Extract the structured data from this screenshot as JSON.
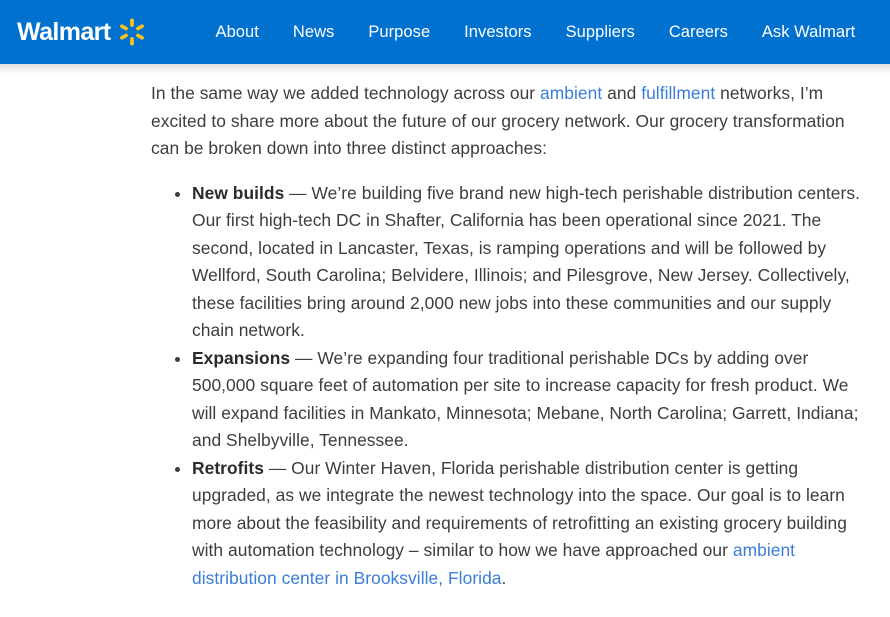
{
  "header": {
    "brand_name": "Walmart",
    "spark_icon": "walmart-spark-icon",
    "background_color": "#0071ce",
    "spark_color": "#ffc220",
    "nav": [
      {
        "label": "About"
      },
      {
        "label": "News"
      },
      {
        "label": "Purpose"
      },
      {
        "label": "Investors"
      },
      {
        "label": "Suppliers"
      },
      {
        "label": "Careers"
      },
      {
        "label": "Ask Walmart"
      }
    ]
  },
  "article": {
    "link_color": "#3b7dd8",
    "text_color": "#3d3d3d",
    "lede": {
      "part1": "In the same way we added technology across our ",
      "link1": "ambient",
      "part2": " and ",
      "link2": "fulfillment",
      "part3": " networks, I’m excited to share more about the future of our grocery network. Our grocery transformation can be broken down into three distinct approaches:"
    },
    "bullets": [
      {
        "term": "New builds",
        "body": " — We’re building five brand new high-tech perishable distribution centers. Our first high-tech DC in Shafter, California has been operational since 2021. The second, located in Lancaster, Texas, is ramping operations and will be followed by Wellford, South Carolina; Belvidere, Illinois; and Pilesgrove, New Jersey. Collectively, these facilities bring around 2,000 new jobs into these communities and our supply chain network."
      },
      {
        "term": "Expansions",
        "body": " — We’re expanding four traditional perishable DCs by adding over 500,000 square feet of automation per site to increase capacity for fresh product. We will expand facilities in Mankato, Minnesota; Mebane, North Carolina; Garrett, Indiana; and Shelbyville, Tennessee."
      },
      {
        "term": "Retrofits",
        "body_before_link": " — Our Winter Haven, Florida perishable distribution center is getting upgraded, as we integrate the newest technology into the space. Our goal is to learn more about the feasibility and requirements of retrofitting an existing grocery building with automation technology – similar to how we have approached our ",
        "link": "ambient distribution center in Brooksville, Florida",
        "body_after_link": "."
      }
    ]
  }
}
